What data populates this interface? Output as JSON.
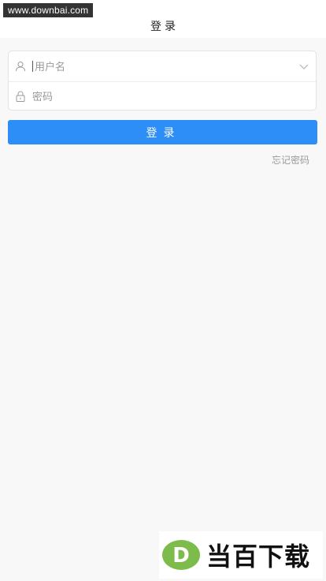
{
  "watermark": {
    "url": "www.downbai.com"
  },
  "header": {
    "title": "登录"
  },
  "form": {
    "username": {
      "placeholder": "用户名",
      "value": ""
    },
    "password": {
      "placeholder": "密码",
      "value": ""
    }
  },
  "actions": {
    "login_label": "登录",
    "forgot_label": "忘记密码"
  },
  "logo": {
    "mark_letter": "D",
    "text": "当百下载"
  },
  "colors": {
    "primary": "#2e8ef7",
    "background": "#f8f8f8",
    "logo_green": "#7dbb4a"
  },
  "icons": {
    "user": "user-icon",
    "lock": "lock-icon",
    "dropdown": "chevron-down-icon"
  }
}
